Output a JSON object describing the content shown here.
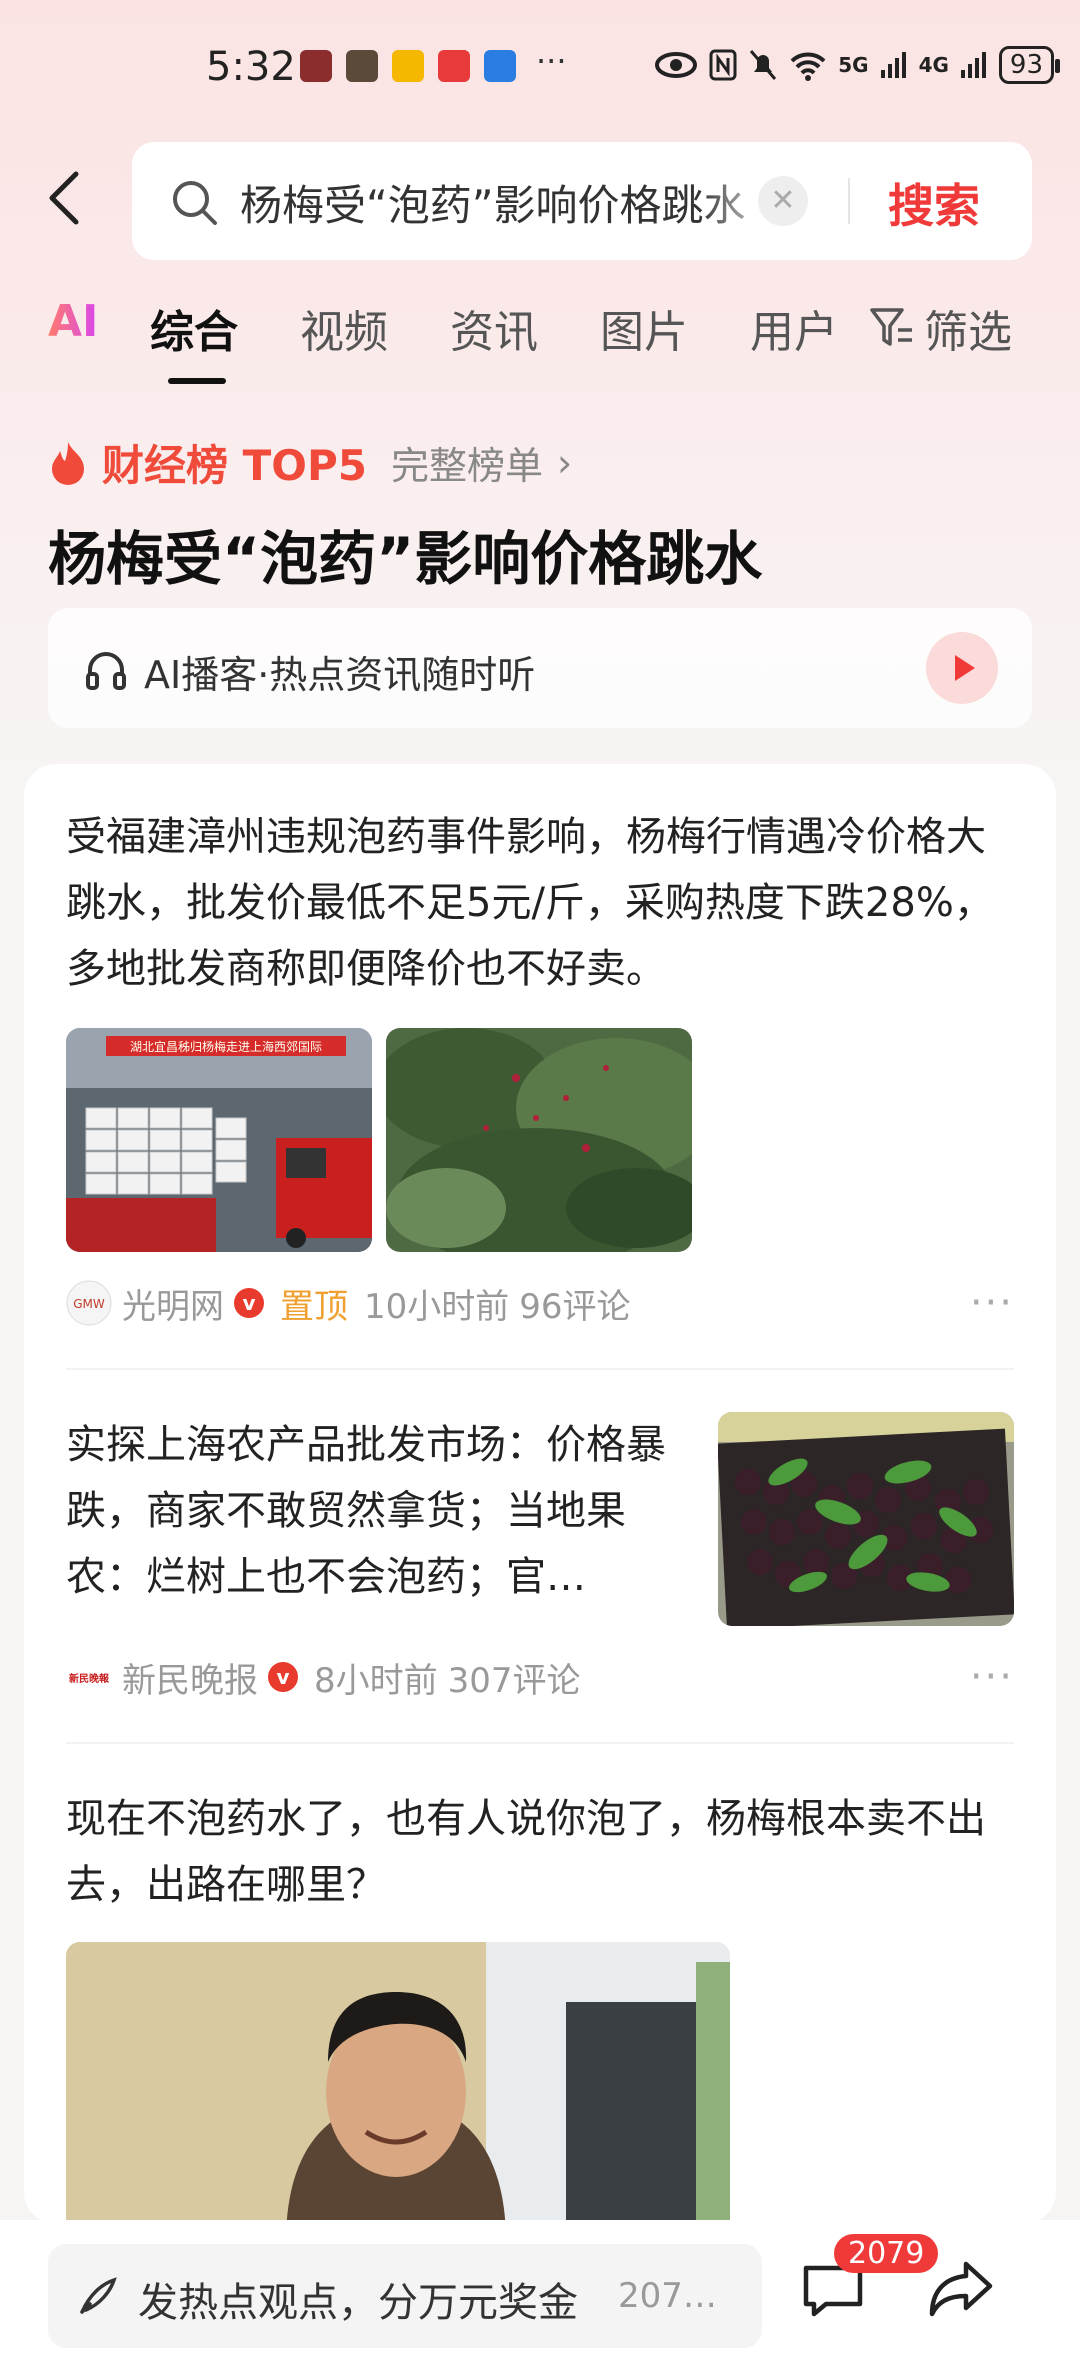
{
  "status_bar": {
    "time": "5:32",
    "network_a": "5G",
    "network_b": "4G",
    "battery": "93"
  },
  "search": {
    "query": "杨梅受“泡药”影响价格跳水",
    "button_label": "搜索",
    "clear_icon": "✕"
  },
  "tabs": {
    "ai": "AI",
    "items": [
      "综合",
      "视频",
      "资讯",
      "图片",
      "用户"
    ],
    "filter_label": "筛选"
  },
  "ranking": {
    "title": "财经榜 TOP5",
    "link": "完整榜单",
    "chevron": "›",
    "headline": "杨梅受“泡药”影响价格跳水",
    "podcast_text": "AI播客·热点资讯随时听"
  },
  "news": [
    {
      "text": "受福建漳州违规泡药事件影响，杨梅行情遇冷价格大跳水，批发价最低不足5元/斤，采购热度下跌28%，多地批发商称即便降价也不好卖。",
      "source": "光明网",
      "verified": "v",
      "pin_label": "置顶",
      "time": "10小时前",
      "comments": "96评论",
      "banner_text": "湖北宜昌秭归杨梅走进上海西郊国际"
    },
    {
      "text": "实探上海农产品批发市场：价格暴跌，商家不敢贸然拿货；当地果农：烂树上也不会泡药；官…",
      "source": "新民晚报",
      "source_logo_text": "新民晚報",
      "verified": "v",
      "time": "8小时前",
      "comments": "307评论"
    },
    {
      "text": "现在不泡药水了，也有人说你泡了，杨梅根本卖不出去，出路在哪里？"
    }
  ],
  "more_label": "···",
  "bottom_bar": {
    "comment_placeholder": "发热点观点，分万元奖金",
    "comment_count_inline": "207…",
    "comment_badge": "2079"
  },
  "colors": {
    "accent_red": "#f03a3a",
    "pin_orange": "#f0a030"
  }
}
